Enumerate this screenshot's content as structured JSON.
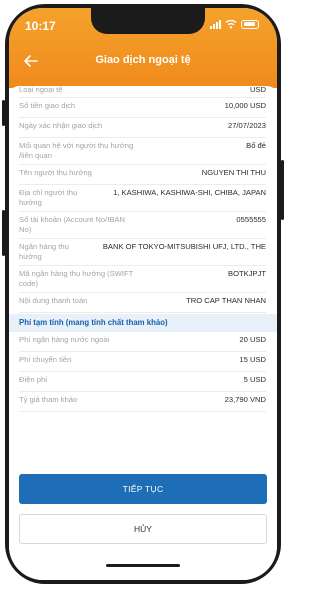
{
  "status": {
    "time": "10:17"
  },
  "header": {
    "title": "Giao dịch ngoại tệ"
  },
  "details": [
    {
      "label": "Loại ngoại tệ",
      "value": "USD"
    },
    {
      "label": "Số tiền giao dịch",
      "value": "10,000 USD"
    },
    {
      "label": "Ngày xác nhận giao dịch",
      "value": "27/07/2023"
    },
    {
      "label": "Mối quan hệ với người thụ hưởng /liên quan",
      "value": "Bố đẻ"
    },
    {
      "label": "Tên người thụ hưởng",
      "value": "NGUYEN THI THU"
    },
    {
      "label": "Địa chỉ người thụ hưởng",
      "value": "1, KASHIWA, KASHIWA-SHI, CHIBA, JAPAN"
    },
    {
      "label": "Số tài khoản (Account No/IBAN No)",
      "value": "0555555"
    },
    {
      "label": "Ngân hàng thụ hưởng",
      "value": "BANK OF TOKYO-MITSUBISHI UFJ, LTD., THE"
    },
    {
      "label": "Mã ngân hàng thụ hưởng (SWIFT code)",
      "value": "BOTKJPJT"
    },
    {
      "label": "Nội dung thanh toán",
      "value": "TRO CAP THAN NHAN"
    }
  ],
  "fees": {
    "section_title": "Phí tạm tính (mang tính chất tham khảo)",
    "items": [
      {
        "label": "Phí ngân hàng nước ngoài",
        "value": "20 USD"
      },
      {
        "label": "Phí chuyển tiền",
        "value": "15 USD"
      },
      {
        "label": "Điện phí",
        "value": "5 USD"
      },
      {
        "label": "Tỷ giá tham khảo",
        "value": "23,790 VND"
      }
    ]
  },
  "actions": {
    "continue_label": "TIẾP TỤC",
    "cancel_label": "HỦY"
  },
  "colors": {
    "header": "#f08a1c",
    "primary": "#1e6db7",
    "section_bg": "#e8f0fa"
  }
}
